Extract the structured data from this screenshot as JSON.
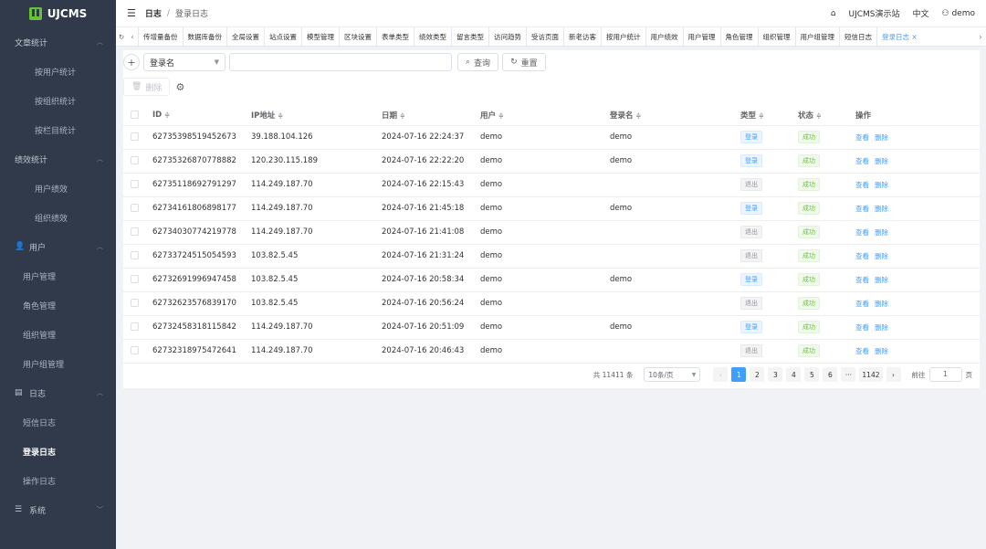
{
  "brand": "UJCMS",
  "sidebar": {
    "groups": [
      {
        "label": "文章统计",
        "icon": "",
        "items": [
          "按用户统计",
          "按组织统计",
          "按栏目统计"
        ]
      },
      {
        "label": "绩效统计",
        "icon": "",
        "items": [
          "用户绩效",
          "组织绩效"
        ]
      },
      {
        "label": "用户",
        "icon": "user-icon",
        "items": [
          "用户管理",
          "角色管理",
          "组织管理",
          "用户组管理"
        ]
      },
      {
        "label": "日志",
        "icon": "log-icon",
        "items": [
          "短信日志",
          "登录日志",
          "操作日志"
        ]
      },
      {
        "label": "系统",
        "icon": "settings-icon",
        "items": []
      }
    ],
    "active": "登录日志"
  },
  "header": {
    "crumb1": "日志",
    "crumb2": "登录日志",
    "site": "UJCMS演示站",
    "lang": "中文",
    "user": "demo"
  },
  "tabs": [
    "传增量备份",
    "数据库备份",
    "全局设置",
    "站点设置",
    "模型管理",
    "区块设置",
    "表单类型",
    "绩效类型",
    "留言类型",
    "访问趋势",
    "受访页面",
    "新老访客",
    "按用户统计",
    "用户绩效",
    "用户管理",
    "角色管理",
    "组织管理",
    "用户组管理",
    "短信日志",
    "登录日志 ×"
  ],
  "toolbar": {
    "field": "登录名",
    "query": "查询",
    "reset": "重置",
    "delete": "删除"
  },
  "columns": [
    "ID",
    "IP地址",
    "日期",
    "用户",
    "登录名",
    "类型",
    "状态",
    "操作"
  ],
  "rows": [
    {
      "id": "627353985194526​73",
      "ip": "39.188.104.126",
      "date": "2024-07-16 22:24:37",
      "user": "demo",
      "login": "demo",
      "type": "登录",
      "status": "成功"
    },
    {
      "id": "62735326870778882",
      "ip": "120.230.115.189",
      "date": "2024-07-16 22:22:20",
      "user": "demo",
      "login": "demo",
      "type": "登录",
      "status": "成功"
    },
    {
      "id": "62735118692791297",
      "ip": "114.249.187.70",
      "date": "2024-07-16 22:15:43",
      "user": "demo",
      "login": "",
      "type": "退出",
      "status": "成功"
    },
    {
      "id": "62734161806898177",
      "ip": "114.249.187.70",
      "date": "2024-07-16 21:45:18",
      "user": "demo",
      "login": "demo",
      "type": "登录",
      "status": "成功"
    },
    {
      "id": "62734030774219778",
      "ip": "114.249.187.70",
      "date": "2024-07-16 21:41:08",
      "user": "demo",
      "login": "",
      "type": "退出",
      "status": "成功"
    },
    {
      "id": "62733724515054593",
      "ip": "103.82.5.45",
      "date": "2024-07-16 21:31:24",
      "user": "demo",
      "login": "",
      "type": "退出",
      "status": "成功"
    },
    {
      "id": "62732691996947458",
      "ip": "103.82.5.45",
      "date": "2024-07-16 20:58:34",
      "user": "demo",
      "login": "demo",
      "type": "登录",
      "status": "成功"
    },
    {
      "id": "62732623576839170",
      "ip": "103.82.5.45",
      "date": "2024-07-16 20:56:24",
      "user": "demo",
      "login": "",
      "type": "退出",
      "status": "成功"
    },
    {
      "id": "62732458318115842",
      "ip": "114.249.187.70",
      "date": "2024-07-16 20:51:09",
      "user": "demo",
      "login": "demo",
      "type": "登录",
      "status": "成功"
    },
    {
      "id": "62732318975472641",
      "ip": "114.249.187.70",
      "date": "2024-07-16 20:46:43",
      "user": "demo",
      "login": "",
      "type": "退出",
      "status": "成功"
    }
  ],
  "actions": {
    "view": "查看",
    "del": "删除"
  },
  "pager": {
    "total": "共 11411 条",
    "size": "10条/页",
    "pages": [
      "1",
      "2",
      "3",
      "4",
      "5",
      "6",
      "···",
      "1142"
    ],
    "current": "1",
    "goto": "前往",
    "goto_value": "1",
    "page_unit": "页"
  }
}
